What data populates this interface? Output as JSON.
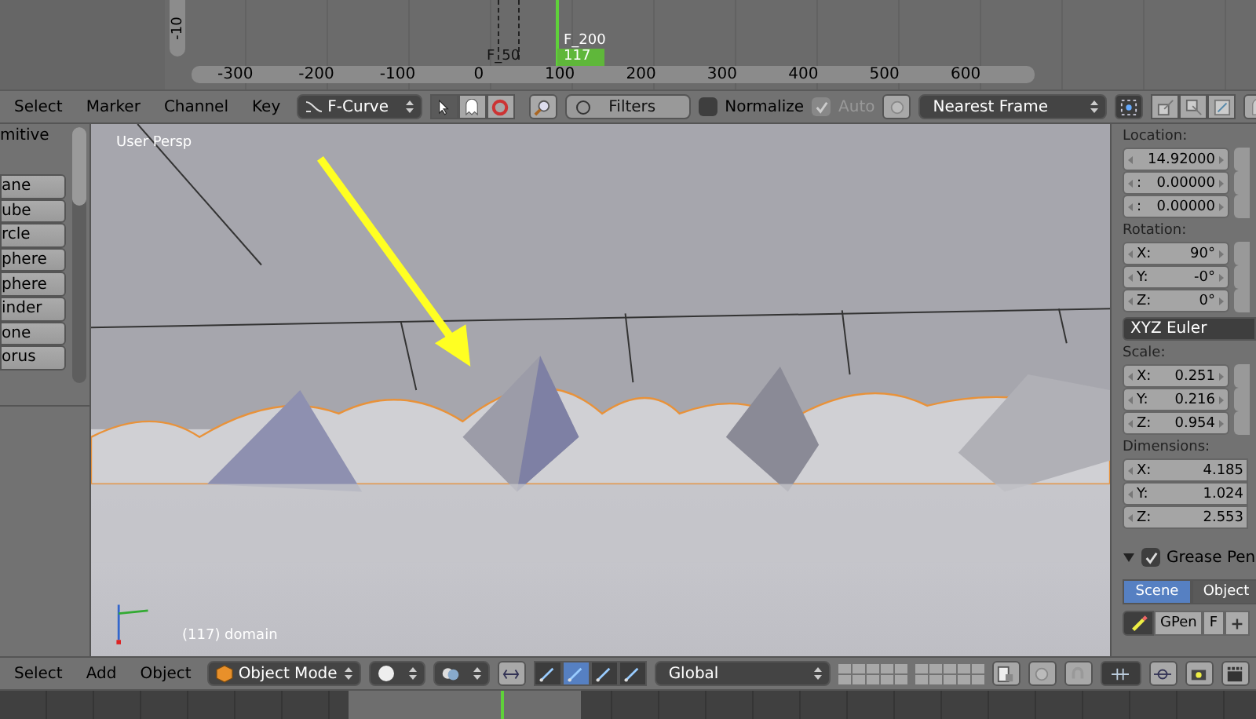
{
  "graph_editor": {
    "axis_label": "-10",
    "ruler_ticks": [
      "-300",
      "-200",
      "-100",
      "0",
      "100",
      "200",
      "300",
      "400",
      "500",
      "600"
    ],
    "current_frame": "117",
    "markers": [
      "F_50",
      "F_200"
    ]
  },
  "graph_header": {
    "menus": [
      "Select",
      "Marker",
      "Channel",
      "Key"
    ],
    "mode": "F-Curve",
    "filters": "Filters",
    "normalize": {
      "label": "Normalize",
      "checked": false
    },
    "auto": {
      "label": "Auto",
      "checked": true,
      "disabled": true
    },
    "snap": "Nearest Frame"
  },
  "tool_shelf": {
    "title": "mitive",
    "buttons": [
      "ane",
      "ube",
      "rcle",
      "phere",
      "phere",
      "inder",
      "one",
      "orus"
    ]
  },
  "viewport": {
    "view_label": "User Persp",
    "object_label": "(117) domain"
  },
  "properties": {
    "location": {
      "label": "Location:",
      "fields": [
        {
          "value": "14.92000"
        },
        {
          "label": ":",
          "value": "0.00000"
        },
        {
          "label": ":",
          "value": "0.00000"
        }
      ]
    },
    "rotation": {
      "label": "Rotation:",
      "fields": [
        {
          "label": "X:",
          "value": "90°"
        },
        {
          "label": "Y:",
          "value": "-0°"
        },
        {
          "label": "Z:",
          "value": "0°"
        }
      ]
    },
    "rotation_mode": "XYZ Euler",
    "scale": {
      "label": "Scale:",
      "fields": [
        {
          "label": "X:",
          "value": "0.251"
        },
        {
          "label": "Y:",
          "value": "0.216"
        },
        {
          "label": "Z:",
          "value": "0.954"
        }
      ]
    },
    "dimensions": {
      "label": "Dimensions:",
      "fields": [
        {
          "label": "X:",
          "value": "4.185"
        },
        {
          "label": "Y:",
          "value": "1.024"
        },
        {
          "label": "Z:",
          "value": "2.553"
        }
      ]
    },
    "grease_pencil": {
      "label": "Grease Pen",
      "checked": true,
      "expanded": true
    },
    "gp_tabs": [
      {
        "label": "Scene",
        "selected": true
      },
      {
        "label": "Object",
        "selected": false
      }
    ],
    "gp_row": [
      "GPen",
      "F"
    ]
  },
  "view_header": {
    "menus": [
      "Select",
      "Add",
      "Object"
    ],
    "mode": "Object Mode",
    "manipulators": [
      {
        "selected": false
      },
      {
        "selected": true
      },
      {
        "selected": false
      },
      {
        "selected": false
      }
    ],
    "orientation": "Global"
  }
}
